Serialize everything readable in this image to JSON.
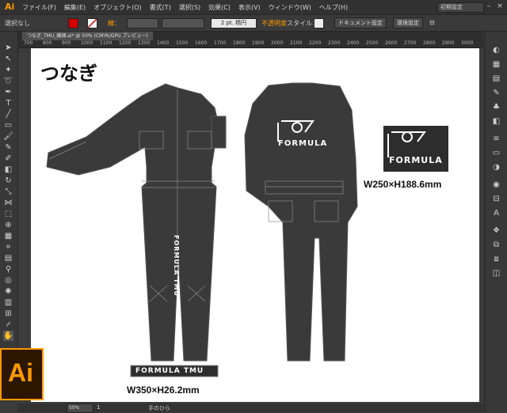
{
  "app": {
    "logo": "Ai",
    "workspace": "初期設定"
  },
  "menu": [
    "ファイル(F)",
    "編集(E)",
    "オブジェクト(O)",
    "書式(T)",
    "選択(S)",
    "効果(C)",
    "表示(V)",
    "ウィンドウ(W)",
    "ヘルプ(H)"
  ],
  "control": {
    "selection": "選択なし",
    "stroke_label": "線：",
    "stroke_weight": "2 pt. 楕円",
    "opacity": "不透明度",
    "style": "スタイル：",
    "doc_settings": "ドキュメント設定",
    "prefs": "環境設定"
  },
  "colors": {
    "fill": "#d40000",
    "accent": "#ff9a00",
    "opacity_text": "#ff9a00"
  },
  "tab": {
    "label": "つなぎ_TMU_繊細.ai* @ 50% (CMYK/GPU プレビュー)"
  },
  "ruler": [
    "700",
    "800",
    "900",
    "1000",
    "1100",
    "1200",
    "1300",
    "1400",
    "1500",
    "1600",
    "1700",
    "1800",
    "1900",
    "2000",
    "2100",
    "2200",
    "2300",
    "2400",
    "2500",
    "2600",
    "2700",
    "2800",
    "2900",
    "3000"
  ],
  "artwork": {
    "title": "つなぎ",
    "logo_text": "FORMULA",
    "leg_text": "FORMULA TMU",
    "strip_text": "FORMULA TMU",
    "dim_strip": "W350×H26.2mm",
    "dim_logo": "W250×H188.6mm"
  },
  "status": {
    "zoom": "50%",
    "page": "1",
    "tool": "手のひら"
  },
  "badge": {
    "text": "Ai"
  }
}
